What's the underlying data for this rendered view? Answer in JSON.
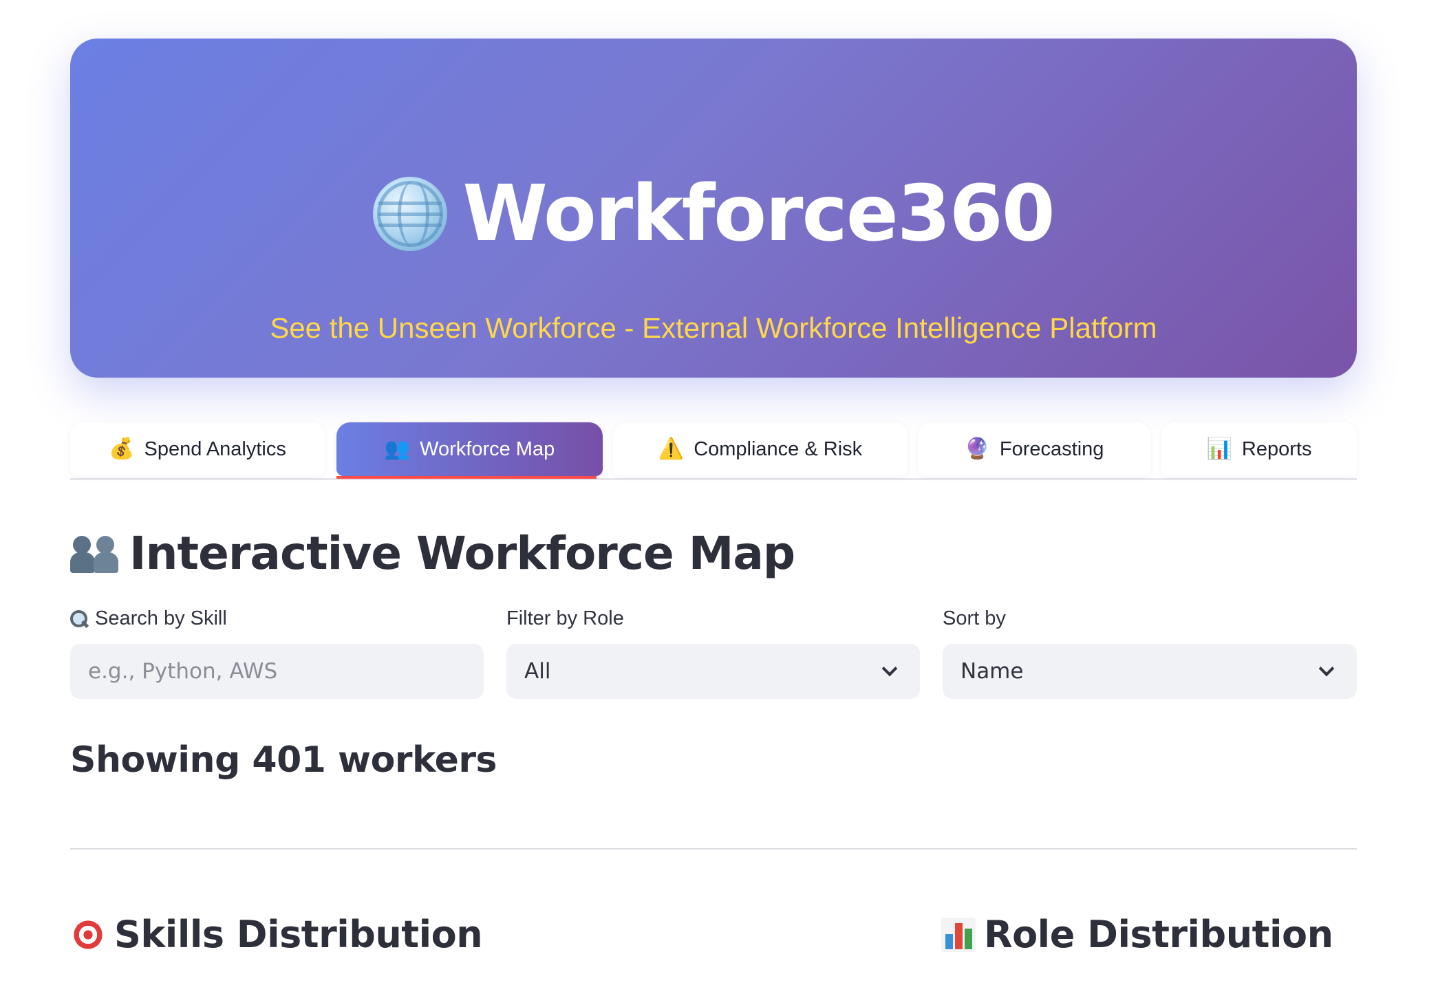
{
  "hero": {
    "title": "Workforce360",
    "subtitle": "See the Unseen Workforce - External Workforce Intelligence Platform",
    "icon": "globe-icon"
  },
  "tabs": [
    {
      "label": "Spend Analytics",
      "icon": "💰",
      "active": false
    },
    {
      "label": "Workforce Map",
      "icon": "👥",
      "active": true
    },
    {
      "label": "Compliance & Risk",
      "icon": "⚠️",
      "active": false
    },
    {
      "label": "Forecasting",
      "icon": "🔮",
      "active": false
    },
    {
      "label": "Reports",
      "icon": "📊",
      "active": false
    }
  ],
  "main": {
    "title": "Interactive Workforce Map",
    "search": {
      "label": "Search by Skill",
      "placeholder": "e.g., Python, AWS",
      "value": ""
    },
    "role_filter": {
      "label": "Filter by Role",
      "value": "All"
    },
    "sort": {
      "label": "Sort by",
      "value": "Name"
    },
    "count_text": "Showing 401 workers",
    "skills_title": "Skills Distribution",
    "roles_title": "Role Distribution"
  },
  "colors": {
    "hero_start": "#6b7fe3",
    "hero_end": "#7a54a8",
    "subtitle": "#ffd84a",
    "tab_underline": "#ff4b4b"
  }
}
